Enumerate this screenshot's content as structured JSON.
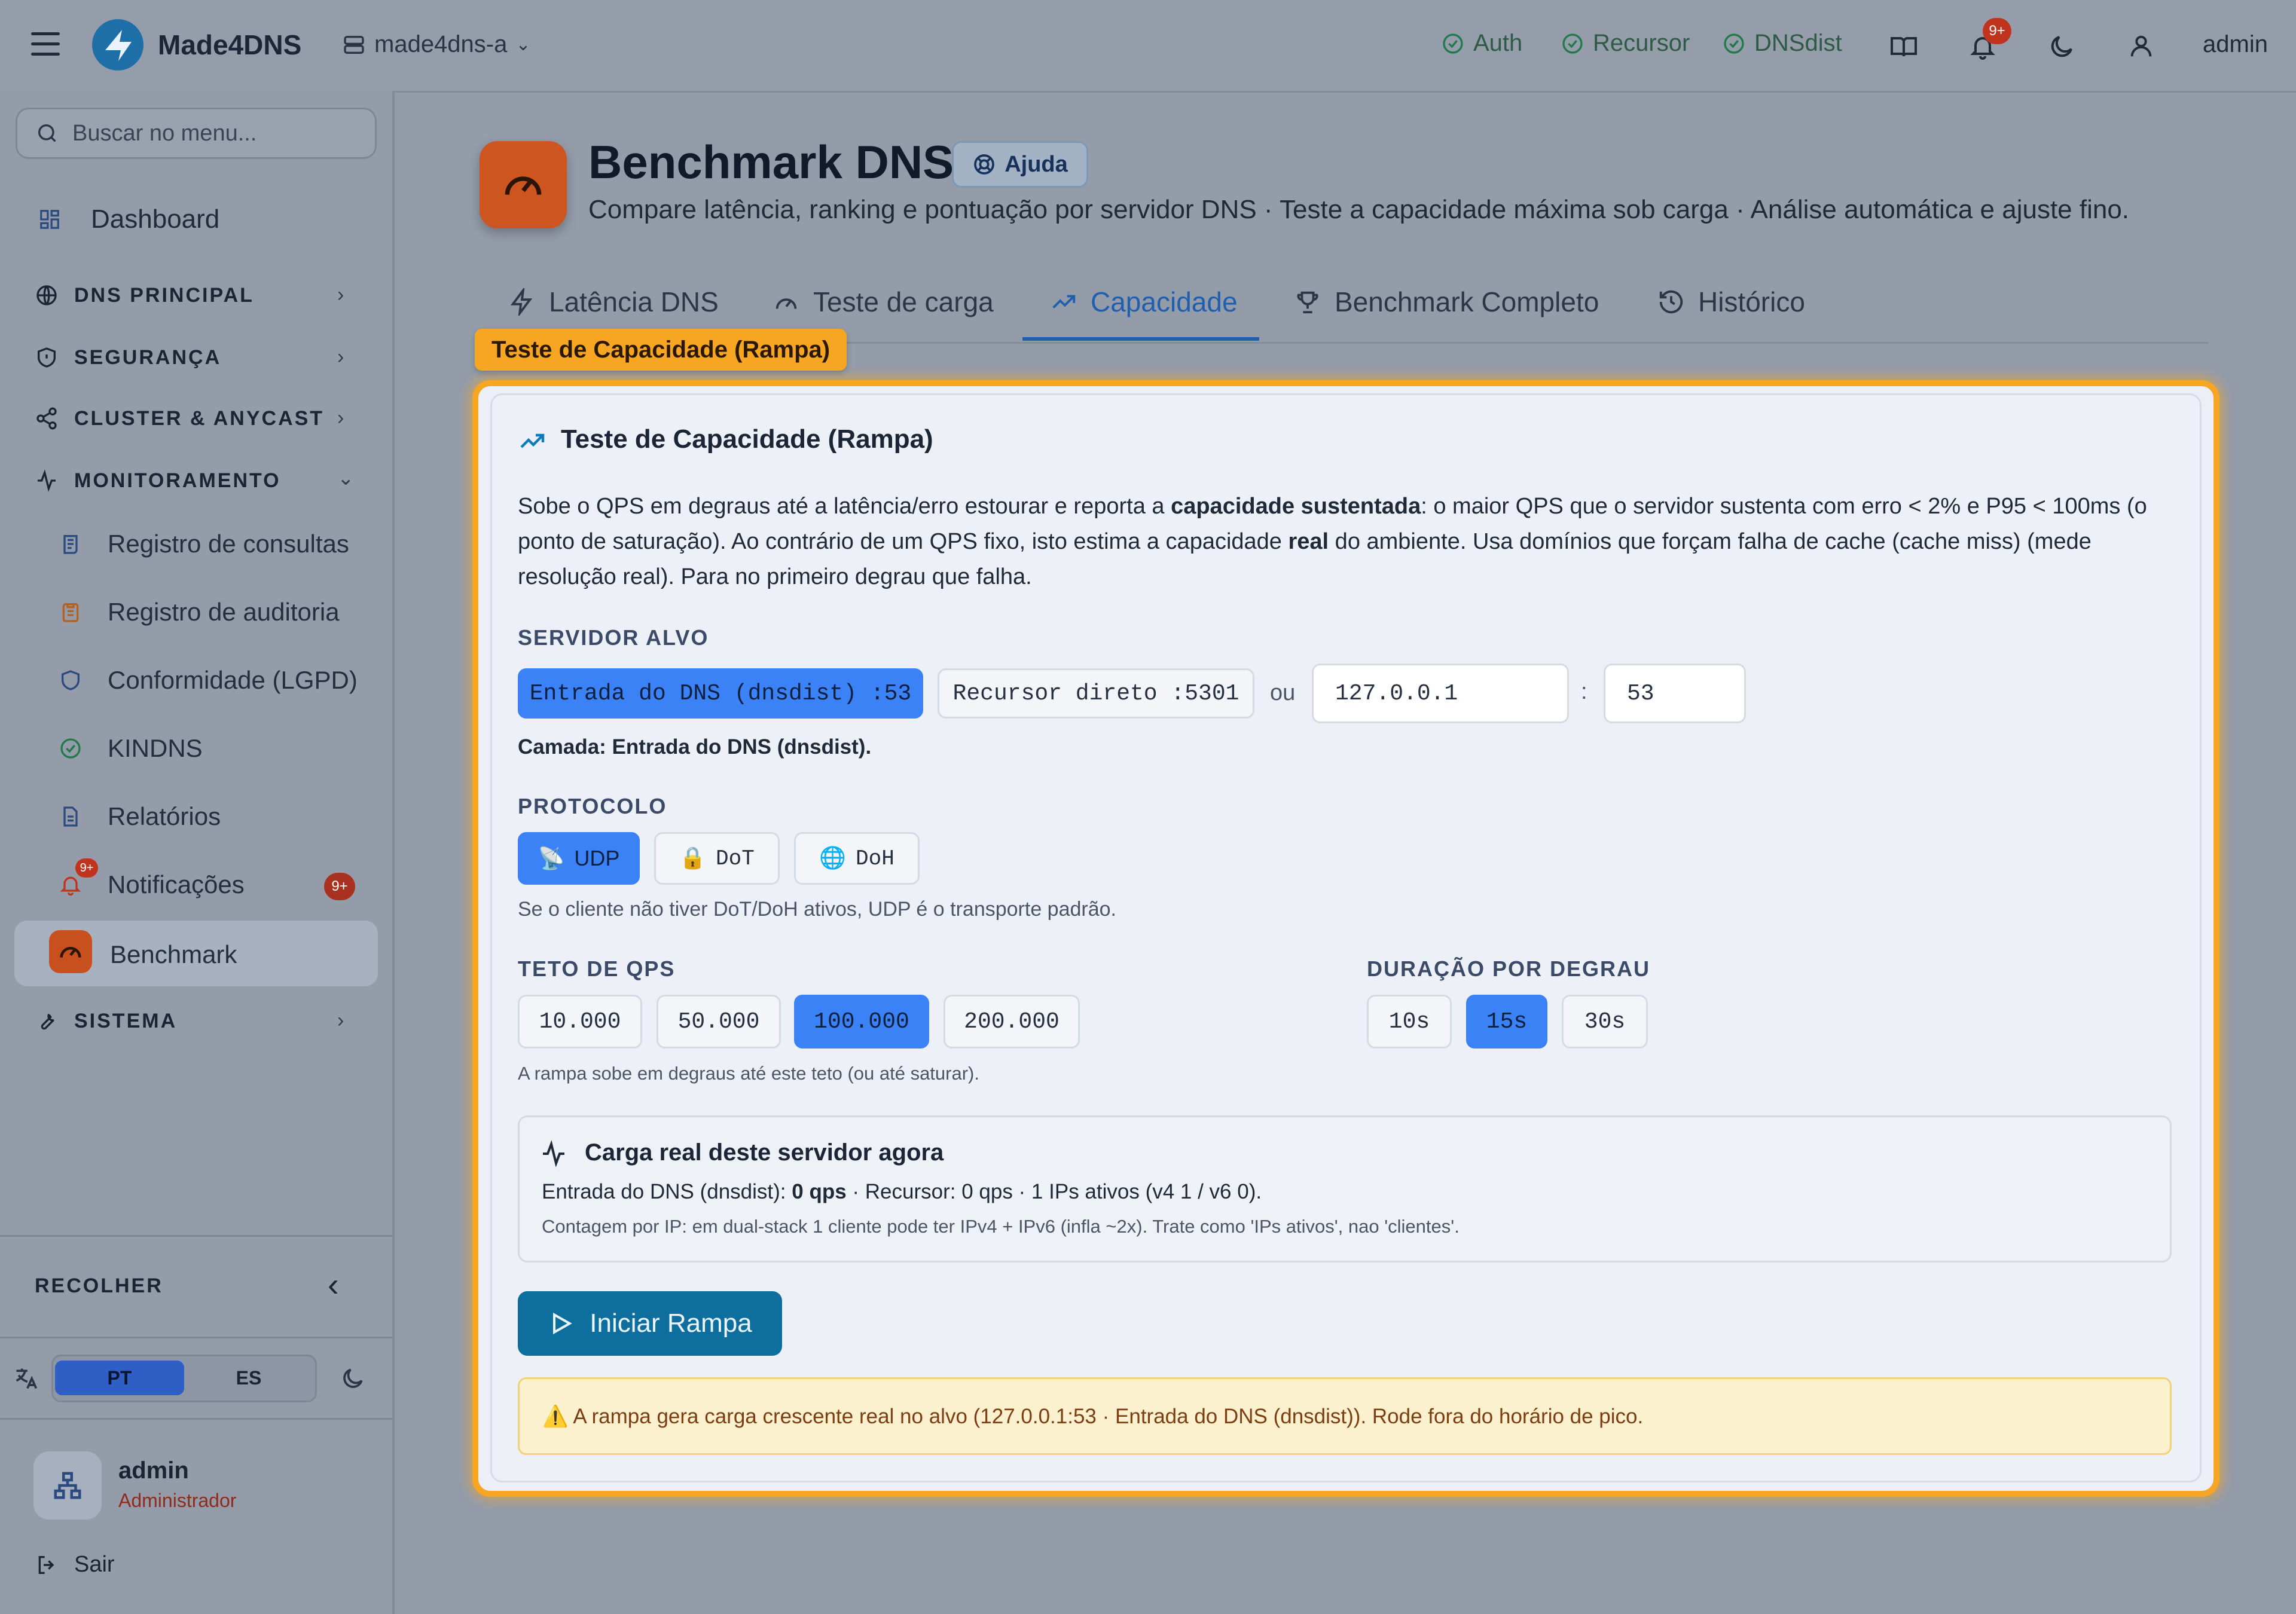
{
  "topbar": {
    "brand": "Made4DNS",
    "instance": "made4dns-a",
    "status": [
      {
        "label": "Auth"
      },
      {
        "label": "Recursor"
      },
      {
        "label": "DNSdist"
      }
    ],
    "notif_badge": "9+",
    "user": "admin"
  },
  "sidebar": {
    "search_placeholder": "Buscar no menu...",
    "dashboard": "Dashboard",
    "sections": {
      "dns": "DNS PRINCIPAL",
      "seg": "SEGURANÇA",
      "cluster": "CLUSTER & ANYCAST",
      "mon": "MONITORAMENTO",
      "sys": "SISTEMA"
    },
    "items": [
      {
        "label": "Registro de consultas"
      },
      {
        "label": "Registro de auditoria"
      },
      {
        "label": "Conformidade (LGPD)"
      },
      {
        "label": "KINDNS"
      },
      {
        "label": "Relatórios"
      },
      {
        "label": "Notificações",
        "badge": "9+"
      },
      {
        "label": "Benchmark"
      }
    ],
    "collapse": "RECOLHER",
    "lang": {
      "pt": "PT",
      "es": "ES"
    },
    "user": {
      "name": "admin",
      "role": "Administrador"
    },
    "logout": "Sair"
  },
  "page": {
    "title": "Benchmark DNS",
    "help": "Ajuda",
    "subtitle": "Compare latência, ranking e pontuação por servidor DNS · Teste a capacidade máxima sob carga · Análise automática e ajuste fino.",
    "tabs": [
      {
        "label": "Latência DNS"
      },
      {
        "label": "Teste de carga"
      },
      {
        "label": "Capacidade"
      },
      {
        "label": "Benchmark Completo"
      },
      {
        "label": "Histórico"
      }
    ],
    "active_tab": "Capacidade",
    "tag": "Teste de Capacidade (Rampa)"
  },
  "card": {
    "title": "Teste de Capacidade (Rampa)",
    "desc": {
      "p1": "Sobe o QPS em degraus até a latência/erro estourar e reporta a ",
      "b1": "capacidade sustentada",
      "p2": ": o maior QPS que o servidor sustenta com erro < 2% e P95 < 100ms (o ponto de saturação). Ao contrário de um QPS fixo, isto estima a capacidade ",
      "b2": "real",
      "p3": " do ambiente. Usa domínios que forçam falha de cache (cache miss) (mede resolução real). Para no primeiro degrau que falha."
    },
    "target": {
      "label": "SERVIDOR ALVO",
      "opt_dnsdist": "Entrada do DNS (dnsdist) :53",
      "opt_recursor": "Recursor direto :5301",
      "or": "ou",
      "host": "127.0.0.1",
      "colon": ":",
      "port": "53",
      "layer": "Camada: Entrada do DNS (dnsdist)."
    },
    "protocol": {
      "label": "PROTOCOLO",
      "options": [
        "UDP",
        "DoT",
        "DoH"
      ],
      "selected": "UDP",
      "note": "Se o cliente não tiver DoT/DoH ativos, UDP é o transporte padrão."
    },
    "qps": {
      "label": "TETO DE QPS",
      "options": [
        "10.000",
        "50.000",
        "100.000",
        "200.000"
      ],
      "selected": "100.000",
      "note": "A rampa sobe em degraus até este teto (ou até saturar)."
    },
    "duration": {
      "label": "DURAÇÃO POR DEGRAU",
      "options": [
        "10s",
        "15s",
        "30s"
      ],
      "selected": "15s"
    },
    "load": {
      "title": "Carga real deste servidor agora",
      "l1_pre": "Entrada do DNS (dnsdist): ",
      "l1_bold": "0 qps",
      "l1_post": " · Recursor: 0 qps · 1 IPs ativos (v4 1 / v6 0).",
      "l2": "Contagem por IP: em dual-stack 1 cliente pode ter IPv4 + IPv6 (infla ~2x). Trate como 'IPs ativos', nao 'clientes'."
    },
    "start": "Iniciar Rampa",
    "warning": "⚠️ A rampa gera carga crescente real no alvo (127.0.0.1:53 · Entrada do DNS (dnsdist)). Rode fora do horário de pico."
  },
  "colors": {
    "accent": "#3b82f6",
    "primary_btn": "#0e6f9e",
    "highlight": "#f6a623",
    "brand_orange": "#d9531e"
  }
}
